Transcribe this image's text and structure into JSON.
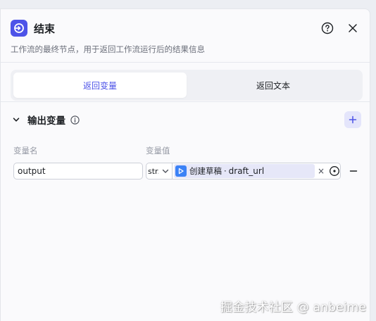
{
  "node": {
    "title": "结束",
    "description": "工作流的最终节点，用于返回工作流运行后的结果信息",
    "icon": "end-node-icon",
    "accent_color": "#4d53e8"
  },
  "header_actions": {
    "help_icon": "help-circle-icon",
    "close_icon": "close-icon"
  },
  "tabs": [
    {
      "label": "返回变量",
      "active": true
    },
    {
      "label": "返回文本",
      "active": false
    }
  ],
  "output_section": {
    "title": "输出变量",
    "col_name_label": "变量名",
    "col_value_label": "变量值"
  },
  "rows": [
    {
      "name": "output",
      "type": "str.",
      "ref_node": "创建草稿",
      "ref_sep": "·",
      "ref_var": "draft_url",
      "clear": "×"
    }
  ],
  "watermark": "掘金技术社区 @ anbeime"
}
